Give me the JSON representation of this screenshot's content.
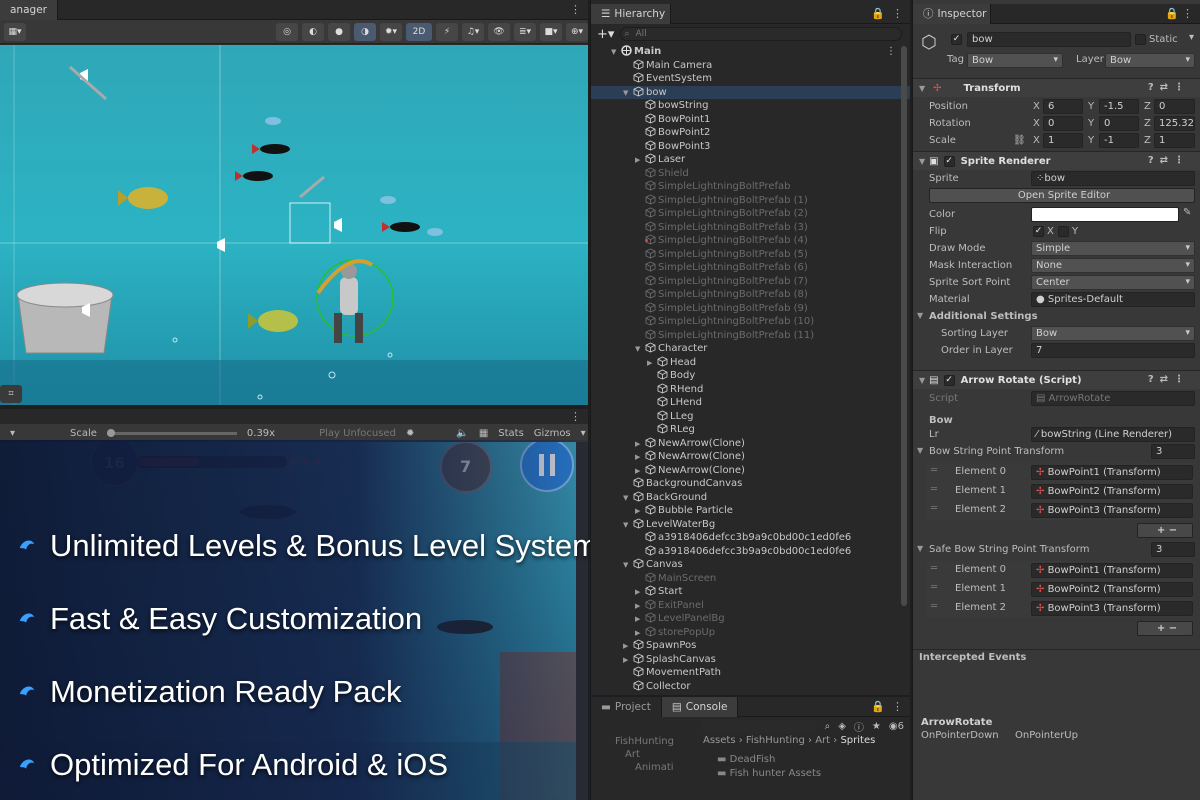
{
  "scene": {
    "tab_label": "anager",
    "toolbar": {
      "mode_2d": "2D"
    }
  },
  "game": {
    "scale_label": "Scale",
    "scale_value": "0.39x",
    "play_mode": "Play Unfocused",
    "stats": "Stats",
    "gizmos": "Gizmos",
    "level_number": "16",
    "arrows_left": "7"
  },
  "features": [
    "Unlimited Levels & Bonus Level System",
    "Fast & Easy Customization",
    "Monetization Ready Pack",
    "Optimized For Android & iOS"
  ],
  "hierarchy": {
    "tab_label": "Hierarchy",
    "search_placeholder": "All",
    "add_label": "+",
    "rows": [
      {
        "name": "Main",
        "depth": 0,
        "expanded": true,
        "kind": "scene",
        "bold": true
      },
      {
        "name": "Main Camera",
        "depth": 1,
        "kind": "go"
      },
      {
        "name": "EventSystem",
        "depth": 1,
        "kind": "go"
      },
      {
        "name": "bow",
        "depth": 1,
        "expanded": true,
        "kind": "go",
        "selected": true
      },
      {
        "name": "bowString",
        "depth": 2,
        "kind": "go"
      },
      {
        "name": "BowPoint1",
        "depth": 2,
        "kind": "go"
      },
      {
        "name": "BowPoint2",
        "depth": 2,
        "kind": "go"
      },
      {
        "name": "BowPoint3",
        "depth": 2,
        "kind": "go"
      },
      {
        "name": "Laser",
        "depth": 2,
        "collapsed": true,
        "kind": "go"
      },
      {
        "name": "Shield",
        "depth": 2,
        "kind": "go",
        "dim": true
      },
      {
        "name": "SimpleLightningBoltPrefab",
        "depth": 2,
        "kind": "go",
        "dim": true
      },
      {
        "name": "SimpleLightningBoltPrefab (1)",
        "depth": 2,
        "kind": "go",
        "dim": true
      },
      {
        "name": "SimpleLightningBoltPrefab (2)",
        "depth": 2,
        "kind": "go",
        "dim": true
      },
      {
        "name": "SimpleLightningBoltPrefab (3)",
        "depth": 2,
        "kind": "go",
        "dim": true
      },
      {
        "name": "SimpleLightningBoltPrefab (4)",
        "depth": 2,
        "kind": "go",
        "dim": true,
        "marker": true
      },
      {
        "name": "SimpleLightningBoltPrefab (5)",
        "depth": 2,
        "kind": "go",
        "dim": true
      },
      {
        "name": "SimpleLightningBoltPrefab (6)",
        "depth": 2,
        "kind": "go",
        "dim": true
      },
      {
        "name": "SimpleLightningBoltPrefab (7)",
        "depth": 2,
        "kind": "go",
        "dim": true
      },
      {
        "name": "SimpleLightningBoltPrefab (8)",
        "depth": 2,
        "kind": "go",
        "dim": true
      },
      {
        "name": "SimpleLightningBoltPrefab (9)",
        "depth": 2,
        "kind": "go",
        "dim": true
      },
      {
        "name": "SimpleLightningBoltPrefab (10)",
        "depth": 2,
        "kind": "go",
        "dim": true
      },
      {
        "name": "SimpleLightningBoltPrefab (11)",
        "depth": 2,
        "kind": "go",
        "dim": true
      },
      {
        "name": "Character",
        "depth": 2,
        "expanded": true,
        "kind": "go"
      },
      {
        "name": "Head",
        "depth": 3,
        "collapsed": true,
        "kind": "go"
      },
      {
        "name": "Body",
        "depth": 3,
        "kind": "go"
      },
      {
        "name": "RHend",
        "depth": 3,
        "kind": "go"
      },
      {
        "name": "LHend",
        "depth": 3,
        "kind": "go"
      },
      {
        "name": "LLeg",
        "depth": 3,
        "kind": "go"
      },
      {
        "name": "RLeg",
        "depth": 3,
        "kind": "go"
      },
      {
        "name": "NewArrow(Clone)",
        "depth": 2,
        "collapsed": true,
        "kind": "go"
      },
      {
        "name": "NewArrow(Clone)",
        "depth": 2,
        "collapsed": true,
        "kind": "go"
      },
      {
        "name": "NewArrow(Clone)",
        "depth": 2,
        "collapsed": true,
        "kind": "go"
      },
      {
        "name": "BackgroundCanvas",
        "depth": 1,
        "kind": "go"
      },
      {
        "name": "BackGround",
        "depth": 1,
        "expanded": true,
        "kind": "go"
      },
      {
        "name": "Bubble Particle",
        "depth": 2,
        "collapsed": true,
        "kind": "go"
      },
      {
        "name": "LevelWaterBg",
        "depth": 1,
        "expanded": true,
        "kind": "go"
      },
      {
        "name": "a3918406defcc3b9a9c0bd00c1ed0fe6",
        "depth": 2,
        "kind": "go"
      },
      {
        "name": "a3918406defcc3b9a9c0bd00c1ed0fe6",
        "depth": 2,
        "kind": "go"
      },
      {
        "name": "Canvas",
        "depth": 1,
        "expanded": true,
        "kind": "go"
      },
      {
        "name": "MainScreen",
        "depth": 2,
        "kind": "go",
        "dim": true
      },
      {
        "name": "Start",
        "depth": 2,
        "collapsed": true,
        "kind": "go"
      },
      {
        "name": "ExitPanel",
        "depth": 2,
        "collapsed": true,
        "kind": "go",
        "dim": true
      },
      {
        "name": "LevelPanelBg",
        "depth": 2,
        "collapsed": true,
        "kind": "go",
        "dim": true
      },
      {
        "name": "storePopUp",
        "depth": 2,
        "collapsed": true,
        "kind": "go",
        "dim": true
      },
      {
        "name": "SpawnPos",
        "depth": 1,
        "collapsed": true,
        "kind": "go"
      },
      {
        "name": "SplashCanvas",
        "depth": 1,
        "collapsed": true,
        "kind": "go"
      },
      {
        "name": "MovementPath",
        "depth": 1,
        "kind": "go"
      },
      {
        "name": "Collector",
        "depth": 1,
        "kind": "go"
      }
    ]
  },
  "project": {
    "tab_project": "Project",
    "tab_console": "Console",
    "breadcrumb": [
      "Assets",
      "FishHunting",
      "Art",
      "Sprites"
    ],
    "tree": [
      "FishHunting",
      "Art",
      "Animati"
    ],
    "files": [
      "DeadFish",
      "Fish hunter Assets"
    ],
    "hidden_count": "6"
  },
  "inspector": {
    "tab_label": "Inspector",
    "object_name": "bow",
    "static_label": "Static",
    "tag_label": "Tag",
    "tag_value": "Bow",
    "layer_label": "Layer",
    "layer_value": "Bow",
    "transform": {
      "title": "Transform",
      "position_label": "Position",
      "rotation_label": "Rotation",
      "scale_label": "Scale",
      "position": {
        "x": "6",
        "y": "-1.5",
        "z": "0"
      },
      "rotation": {
        "x": "0",
        "y": "0",
        "z": "125.327"
      },
      "scale": {
        "x": "1",
        "y": "-1",
        "z": "1"
      }
    },
    "sprite_renderer": {
      "title": "Sprite Renderer",
      "sprite_label": "Sprite",
      "sprite_value": "bow",
      "open_editor": "Open Sprite Editor",
      "color_label": "Color",
      "flip_label": "Flip",
      "flip_x": "X",
      "flip_y": "Y",
      "draw_mode_label": "Draw Mode",
      "draw_mode": "Simple",
      "mask_label": "Mask Interaction",
      "mask": "None",
      "sort_point_label": "Sprite Sort Point",
      "sort_point": "Center",
      "material_label": "Material",
      "material": "Sprites-Default",
      "additional": "Additional Settings",
      "sorting_layer_label": "Sorting Layer",
      "sorting_layer": "Bow",
      "order_label": "Order in Layer",
      "order": "7"
    },
    "arrow_rotate": {
      "title": "Arrow Rotate (Script)",
      "script_label": "Script",
      "script_value": "ArrowRotate",
      "section_bow": "Bow",
      "lr_label": "Lr",
      "lr_value": "bowString (Line Renderer)",
      "list1_label": "Bow String Point Transform",
      "list1_count": "3",
      "list1": [
        {
          "label": "Element 0",
          "value": "BowPoint1 (Transform)"
        },
        {
          "label": "Element 1",
          "value": "BowPoint2 (Transform)"
        },
        {
          "label": "Element 2",
          "value": "BowPoint3 (Transform)"
        }
      ],
      "list2_label": "Safe Bow String Point Transform",
      "list2_count": "3",
      "list2": [
        {
          "label": "Element 0",
          "value": "BowPoint1 (Transform)"
        },
        {
          "label": "Element 1",
          "value": "BowPoint2 (Transform)"
        },
        {
          "label": "Element 2",
          "value": "BowPoint3 (Transform)"
        }
      ],
      "plus": "+",
      "minus": "−"
    },
    "intercepted": "Intercepted Events",
    "events_class": "ArrowRotate",
    "events": [
      "OnPointerDown",
      "OnPointerUp"
    ]
  },
  "colors": {
    "accent_blue": "#2c3e55",
    "selection": "#2c3e55",
    "overlay": "#13214a",
    "water": "#2cb3c3"
  }
}
